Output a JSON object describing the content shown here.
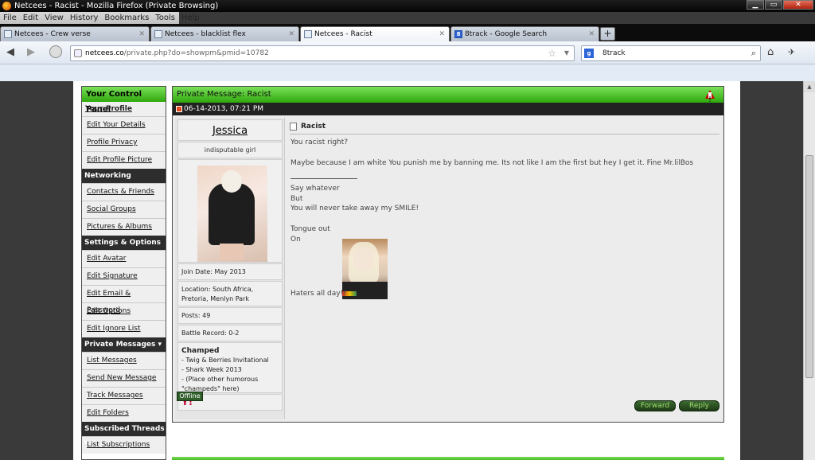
{
  "window": {
    "title": "Netcees - Racist - Mozilla Firefox (Private Browsing)"
  },
  "menu": [
    "File",
    "Edit",
    "View",
    "History",
    "Bookmarks",
    "Tools",
    "Help"
  ],
  "tabs": [
    {
      "label": "Netcees - Crew verse",
      "active": false
    },
    {
      "label": "Netcees - blacklist flex",
      "active": false
    },
    {
      "label": "Netcees - Racist",
      "active": true
    },
    {
      "label": "8track - Google Search",
      "active": false
    }
  ],
  "newtab": "+",
  "url": {
    "host": "netcees.co",
    "path": "/private.php?do=showpm&pmid=10782"
  },
  "search": {
    "value": "8track"
  },
  "sidebar": {
    "title": "Your Control Panel",
    "your_profile": "Your Profile",
    "profile_items": [
      "Edit Your Details",
      "Profile Privacy",
      "Edit Profile Picture"
    ],
    "networking_head": "Networking",
    "networking_items": [
      "Contacts & Friends",
      "Social Groups",
      "Pictures & Albums"
    ],
    "settings_head": "Settings & Options",
    "settings_items": [
      "Edit Avatar",
      "Edit Signature",
      "Edit Email & Password",
      "Edit Options",
      "Edit Ignore List"
    ],
    "pm_head": "Private Messages ▾",
    "pm_items": [
      "List Messages",
      "Send New Message",
      "Track Messages",
      "Edit Folders"
    ],
    "threads_head": "Subscribed Threads ▾",
    "threads_items": [
      "List Subscriptions"
    ]
  },
  "pm": {
    "header_prefix": "Private Message:",
    "header_subject": "Racist",
    "date": "06-14-2013, 07:21 PM"
  },
  "user": {
    "name": "Jessica",
    "title": "indisputable girl",
    "join_date": "Join Date: May 2013",
    "location": "Location: South Africa, Pretoria, Menlyn Park",
    "posts": "Posts: 49",
    "battle": "Battle Record: 0-2",
    "champed_head": "Champed",
    "champed_items": [
      "- Twig & Berries Invitational",
      "- Shark Week 2013",
      "- (Place other humorous \"champeds\" here)"
    ],
    "yahoo": "Y!",
    "status": "Offline"
  },
  "message": {
    "subject": "Racist",
    "line1": "You racist right?",
    "line2": "Maybe because I am white You punish me by banning me. Its not like I am the first but hey I get it. Fine Mr.lilBos",
    "sig1": "Say whatever",
    "sig2": "But",
    "sig3": "You will never take away my SMILE!",
    "sig4": "Tongue out",
    "sig5": "On",
    "sig6": "Haters all day!!"
  },
  "buttons": {
    "forward": "Forward",
    "reply": "Reply"
  }
}
